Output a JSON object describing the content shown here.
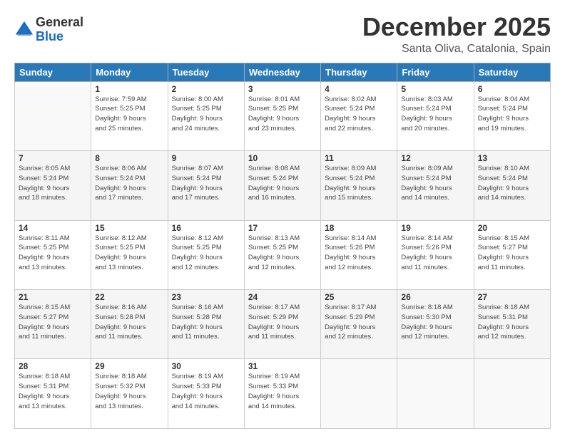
{
  "logo": {
    "general": "General",
    "blue": "Blue"
  },
  "title": "December 2025",
  "subtitle": "Santa Oliva, Catalonia, Spain",
  "days_header": [
    "Sunday",
    "Monday",
    "Tuesday",
    "Wednesday",
    "Thursday",
    "Friday",
    "Saturday"
  ],
  "weeks": [
    [
      {
        "num": "",
        "info": ""
      },
      {
        "num": "1",
        "info": "Sunrise: 7:59 AM\nSunset: 5:25 PM\nDaylight: 9 hours\nand 25 minutes."
      },
      {
        "num": "2",
        "info": "Sunrise: 8:00 AM\nSunset: 5:25 PM\nDaylight: 9 hours\nand 24 minutes."
      },
      {
        "num": "3",
        "info": "Sunrise: 8:01 AM\nSunset: 5:25 PM\nDaylight: 9 hours\nand 23 minutes."
      },
      {
        "num": "4",
        "info": "Sunrise: 8:02 AM\nSunset: 5:24 PM\nDaylight: 9 hours\nand 22 minutes."
      },
      {
        "num": "5",
        "info": "Sunrise: 8:03 AM\nSunset: 5:24 PM\nDaylight: 9 hours\nand 20 minutes."
      },
      {
        "num": "6",
        "info": "Sunrise: 8:04 AM\nSunset: 5:24 PM\nDaylight: 9 hours\nand 19 minutes."
      }
    ],
    [
      {
        "num": "7",
        "info": "Sunrise: 8:05 AM\nSunset: 5:24 PM\nDaylight: 9 hours\nand 18 minutes."
      },
      {
        "num": "8",
        "info": "Sunrise: 8:06 AM\nSunset: 5:24 PM\nDaylight: 9 hours\nand 17 minutes."
      },
      {
        "num": "9",
        "info": "Sunrise: 8:07 AM\nSunset: 5:24 PM\nDaylight: 9 hours\nand 17 minutes."
      },
      {
        "num": "10",
        "info": "Sunrise: 8:08 AM\nSunset: 5:24 PM\nDaylight: 9 hours\nand 16 minutes."
      },
      {
        "num": "11",
        "info": "Sunrise: 8:09 AM\nSunset: 5:24 PM\nDaylight: 9 hours\nand 15 minutes."
      },
      {
        "num": "12",
        "info": "Sunrise: 8:09 AM\nSunset: 5:24 PM\nDaylight: 9 hours\nand 14 minutes."
      },
      {
        "num": "13",
        "info": "Sunrise: 8:10 AM\nSunset: 5:24 PM\nDaylight: 9 hours\nand 14 minutes."
      }
    ],
    [
      {
        "num": "14",
        "info": "Sunrise: 8:11 AM\nSunset: 5:25 PM\nDaylight: 9 hours\nand 13 minutes."
      },
      {
        "num": "15",
        "info": "Sunrise: 8:12 AM\nSunset: 5:25 PM\nDaylight: 9 hours\nand 13 minutes."
      },
      {
        "num": "16",
        "info": "Sunrise: 8:12 AM\nSunset: 5:25 PM\nDaylight: 9 hours\nand 12 minutes."
      },
      {
        "num": "17",
        "info": "Sunrise: 8:13 AM\nSunset: 5:25 PM\nDaylight: 9 hours\nand 12 minutes."
      },
      {
        "num": "18",
        "info": "Sunrise: 8:14 AM\nSunset: 5:26 PM\nDaylight: 9 hours\nand 12 minutes."
      },
      {
        "num": "19",
        "info": "Sunrise: 8:14 AM\nSunset: 5:26 PM\nDaylight: 9 hours\nand 11 minutes."
      },
      {
        "num": "20",
        "info": "Sunrise: 8:15 AM\nSunset: 5:27 PM\nDaylight: 9 hours\nand 11 minutes."
      }
    ],
    [
      {
        "num": "21",
        "info": "Sunrise: 8:15 AM\nSunset: 5:27 PM\nDaylight: 9 hours\nand 11 minutes."
      },
      {
        "num": "22",
        "info": "Sunrise: 8:16 AM\nSunset: 5:28 PM\nDaylight: 9 hours\nand 11 minutes."
      },
      {
        "num": "23",
        "info": "Sunrise: 8:16 AM\nSunset: 5:28 PM\nDaylight: 9 hours\nand 11 minutes."
      },
      {
        "num": "24",
        "info": "Sunrise: 8:17 AM\nSunset: 5:29 PM\nDaylight: 9 hours\nand 11 minutes."
      },
      {
        "num": "25",
        "info": "Sunrise: 8:17 AM\nSunset: 5:29 PM\nDaylight: 9 hours\nand 12 minutes."
      },
      {
        "num": "26",
        "info": "Sunrise: 8:18 AM\nSunset: 5:30 PM\nDaylight: 9 hours\nand 12 minutes."
      },
      {
        "num": "27",
        "info": "Sunrise: 8:18 AM\nSunset: 5:31 PM\nDaylight: 9 hours\nand 12 minutes."
      }
    ],
    [
      {
        "num": "28",
        "info": "Sunrise: 8:18 AM\nSunset: 5:31 PM\nDaylight: 9 hours\nand 13 minutes."
      },
      {
        "num": "29",
        "info": "Sunrise: 8:18 AM\nSunset: 5:32 PM\nDaylight: 9 hours\nand 13 minutes."
      },
      {
        "num": "30",
        "info": "Sunrise: 8:19 AM\nSunset: 5:33 PM\nDaylight: 9 hours\nand 14 minutes."
      },
      {
        "num": "31",
        "info": "Sunrise: 8:19 AM\nSunset: 5:33 PM\nDaylight: 9 hours\nand 14 minutes."
      },
      {
        "num": "",
        "info": ""
      },
      {
        "num": "",
        "info": ""
      },
      {
        "num": "",
        "info": ""
      }
    ]
  ]
}
